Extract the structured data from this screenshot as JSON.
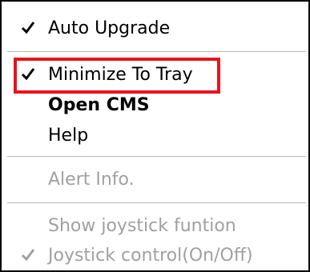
{
  "menu": {
    "items": [
      {
        "label": "Auto Upgrade",
        "checked": true,
        "enabled": true
      },
      {
        "label": "Minimize To Tray",
        "checked": true,
        "enabled": true,
        "highlighted": true
      },
      {
        "label": "Open CMS",
        "checked": false,
        "enabled": true,
        "bold": true
      },
      {
        "label": "Help",
        "checked": false,
        "enabled": true
      },
      {
        "label": "Alert Info.",
        "checked": false,
        "enabled": false
      },
      {
        "label": "Show joystick funtion",
        "checked": false,
        "enabled": false
      },
      {
        "label": "Joystick control(On/Off)",
        "checked": true,
        "enabled": false
      }
    ]
  },
  "colors": {
    "highlight_border": "#e8141c",
    "disabled_text": "#a0a0a0",
    "separator": "#b8b8b8"
  },
  "icons": {
    "check": "check-icon"
  }
}
